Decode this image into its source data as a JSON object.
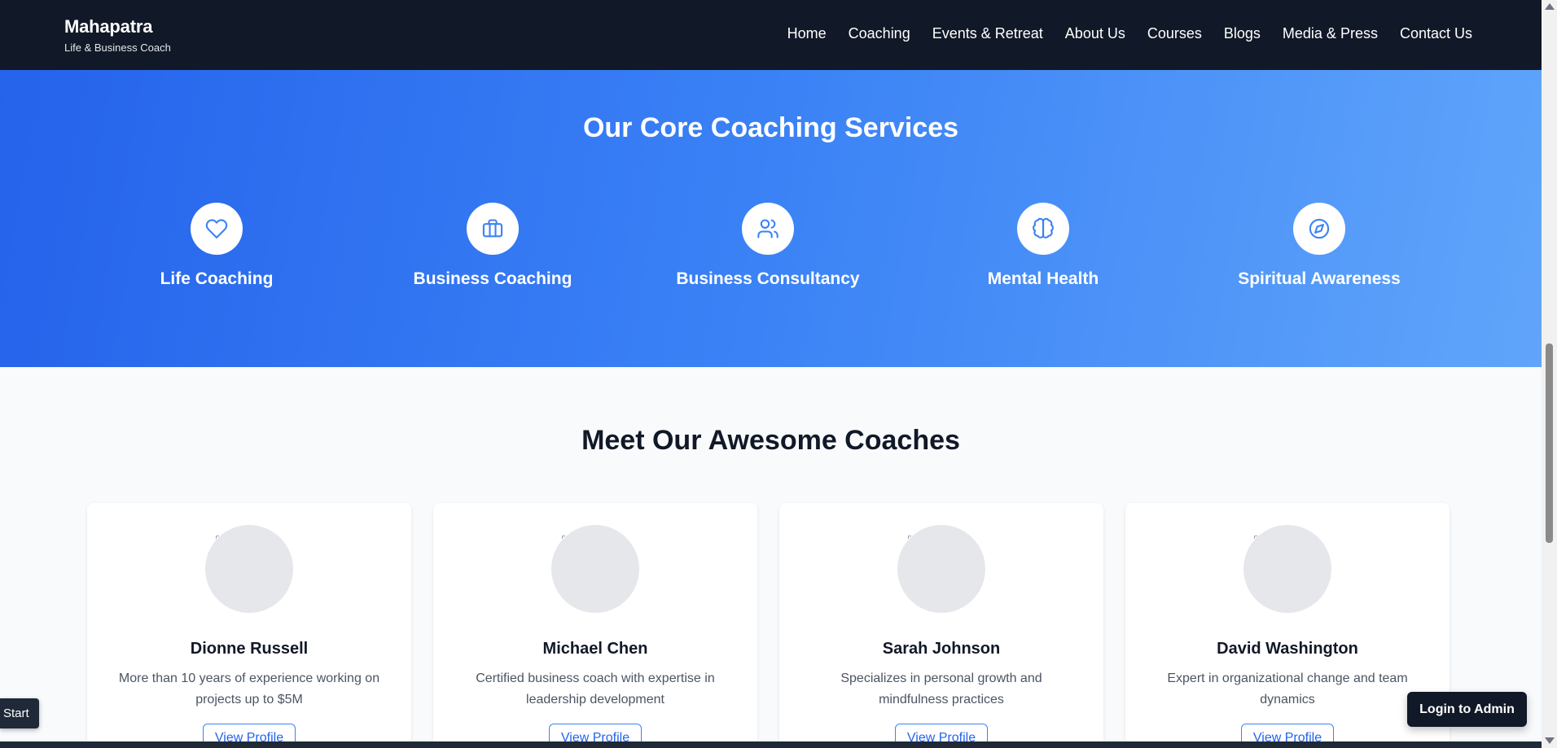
{
  "header": {
    "brand_name": "Mahapatra",
    "brand_tagline": "Life & Business Coach",
    "nav": [
      "Home",
      "Coaching",
      "Events & Retreat",
      "About Us",
      "Courses",
      "Blogs",
      "Media & Press",
      "Contact Us"
    ]
  },
  "services": {
    "title": "Our Core Coaching Services",
    "items": [
      {
        "label": "Life Coaching",
        "icon": "heart-icon"
      },
      {
        "label": "Business Coaching",
        "icon": "briefcase-icon"
      },
      {
        "label": "Business Consultancy",
        "icon": "users-icon"
      },
      {
        "label": "Mental Health",
        "icon": "brain-icon"
      },
      {
        "label": "Spiritual Awareness",
        "icon": "compass-icon"
      }
    ]
  },
  "coaches": {
    "title": "Meet Our Awesome Coaches",
    "items": [
      {
        "name": "Dionne Russell",
        "description": "More than 10 years of experience working on projects up to $5M",
        "button": "View Profile"
      },
      {
        "name": "Michael Chen",
        "description": "Certified business coach with expertise in leadership development",
        "button": "View Profile"
      },
      {
        "name": "Sarah Johnson",
        "description": "Specializes in personal growth and mindfulness practices",
        "button": "View Profile"
      },
      {
        "name": "David Washington",
        "description": "Expert in organizational change and team dynamics",
        "button": "View Profile"
      }
    ]
  },
  "floating": {
    "start_label": "Start",
    "admin_label": "Login to Admin"
  },
  "colors": {
    "header_bg": "#111827",
    "accent": "#3b82f6",
    "gradient_start": "#2563eb",
    "gradient_end": "#60a5fa"
  }
}
